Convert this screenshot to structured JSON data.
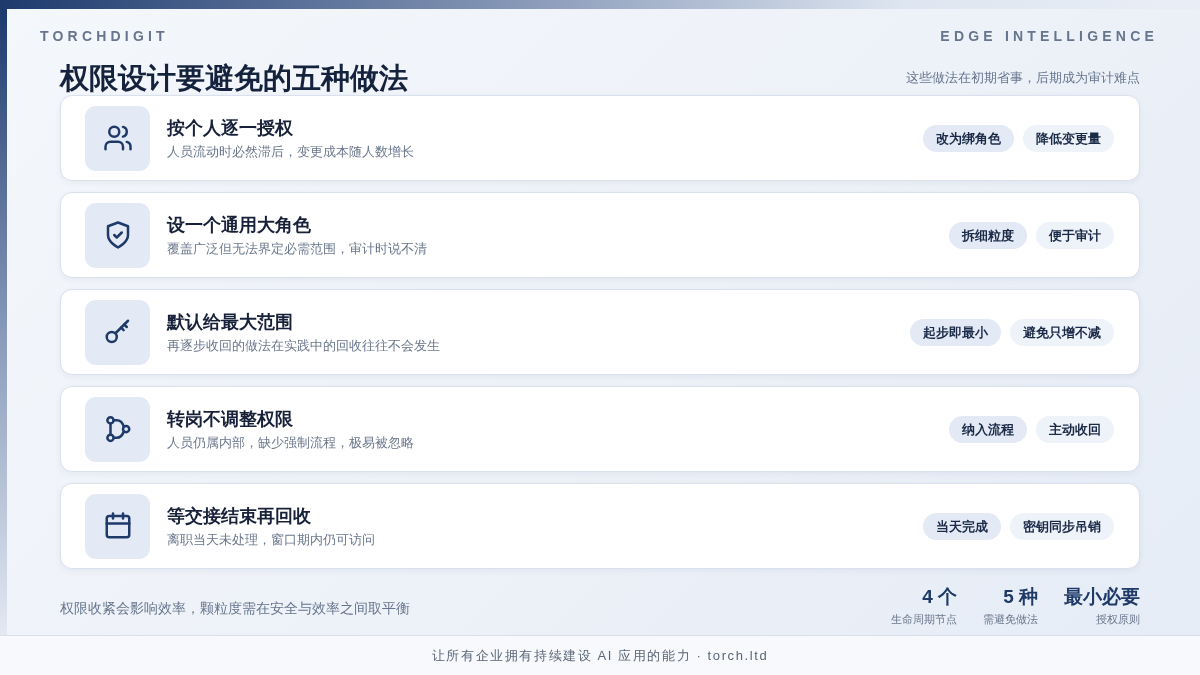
{
  "brand": {
    "left": "TORCHDIGIT",
    "right": "EDGE INTELLIGENCE"
  },
  "header": {
    "title": "权限设计要避免的五种做法",
    "subtitle": "这些做法在初期省事，后期成为审计难点"
  },
  "items": [
    {
      "title": "按个人逐一授权",
      "description": "人员流动时必然滞后，变更成本随人数增长",
      "tags": [
        "改为绑角色",
        "降低变更量"
      ]
    },
    {
      "title": "设一个通用大角色",
      "description": "覆盖广泛但无法界定必需范围，审计时说不清",
      "tags": [
        "拆细粒度",
        "便于审计"
      ]
    },
    {
      "title": "默认给最大范围",
      "description": "再逐步收回的做法在实践中的回收往往不会发生",
      "tags": [
        "起步即最小",
        "避免只增不减"
      ]
    },
    {
      "title": "转岗不调整权限",
      "description": "人员仍属内部，缺少强制流程，极易被忽略",
      "tags": [
        "纳入流程",
        "主动收回"
      ]
    },
    {
      "title": "等交接结束再回收",
      "description": "离职当天未处理，窗口期内仍可访问",
      "tags": [
        "当天完成",
        "密钥同步吊销"
      ]
    }
  ],
  "footer": {
    "note": "权限收紧会影响效率，颗粒度需在安全与效率之间取平衡",
    "stats": [
      {
        "value": "4 个",
        "label": "生命周期节点"
      },
      {
        "value": "5 种",
        "label": "需避免做法"
      },
      {
        "value": "最小必要",
        "label": "授权原则"
      }
    ]
  },
  "bottom_bar": {
    "text": "让所有企业拥有持续建设 AI 应用的能力 · torch.ltd"
  }
}
